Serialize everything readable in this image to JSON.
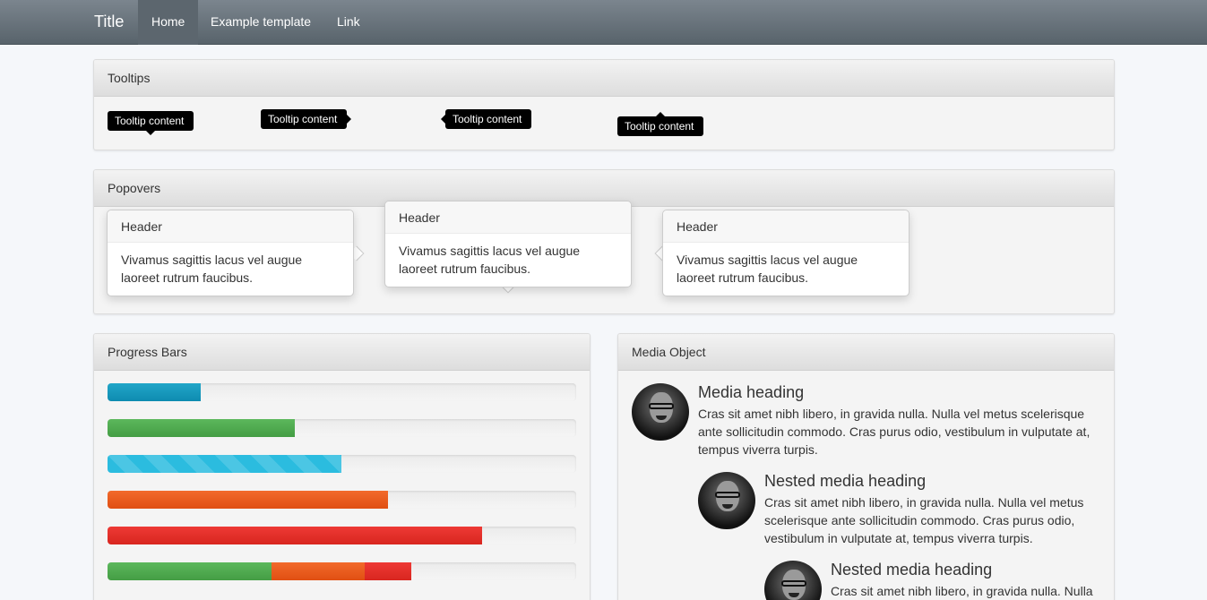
{
  "navbar": {
    "brand": "Title",
    "links": [
      "Home",
      "Example template",
      "Link"
    ]
  },
  "tooltips": {
    "title": "Tooltips",
    "items": [
      "Tooltip content",
      "Tooltip content",
      "Tooltip content",
      "Tooltip content"
    ],
    "placements": [
      "top",
      "right",
      "left",
      "bottom"
    ]
  },
  "popovers": {
    "title": "Popovers",
    "items": [
      {
        "header": "Header",
        "content": "Vivamus sagittis lacus vel augue laoreet rutrum faucibus.",
        "placement": "left"
      },
      {
        "header": "Header",
        "content": "Vivamus sagittis lacus vel augue laoreet rutrum faucibus.",
        "placement": "top"
      },
      {
        "header": "Header",
        "content": "Vivamus sagittis lacus vel augue laoreet rutrum faucibus.",
        "placement": "right"
      }
    ]
  },
  "progress": {
    "title": "Progress Bars",
    "bars": [
      {
        "type": "info",
        "percent": 20
      },
      {
        "type": "success",
        "percent": 40
      },
      {
        "type": "info-striped",
        "percent": 50
      },
      {
        "type": "warning",
        "percent": 60
      },
      {
        "type": "danger",
        "percent": 80
      },
      {
        "type": "stacked",
        "segments": [
          {
            "type": "success",
            "percent": 35
          },
          {
            "type": "warning",
            "percent": 20
          },
          {
            "type": "danger",
            "percent": 10
          }
        ]
      }
    ]
  },
  "media": {
    "title": "Media Object",
    "items": [
      {
        "heading": "Media heading",
        "text": "Cras sit amet nibh libero, in gravida nulla. Nulla vel metus scelerisque ante sollicitudin commodo. Cras purus odio, vestibulum in vulputate at, tempus viverra turpis."
      },
      {
        "heading": "Nested media heading",
        "text": "Cras sit amet nibh libero, in gravida nulla. Nulla vel metus scelerisque ante sollicitudin commodo. Cras purus odio, vestibulum in vulputate at, tempus viverra turpis."
      },
      {
        "heading": "Nested media heading",
        "text": "Cras sit amet nibh libero, in gravida nulla. Nulla"
      }
    ]
  },
  "colors": {
    "navbar": "#6b757d",
    "info": "#0e8bb0",
    "success": "#5cb85c",
    "warning": "#e04f12",
    "danger": "#d8261f"
  }
}
